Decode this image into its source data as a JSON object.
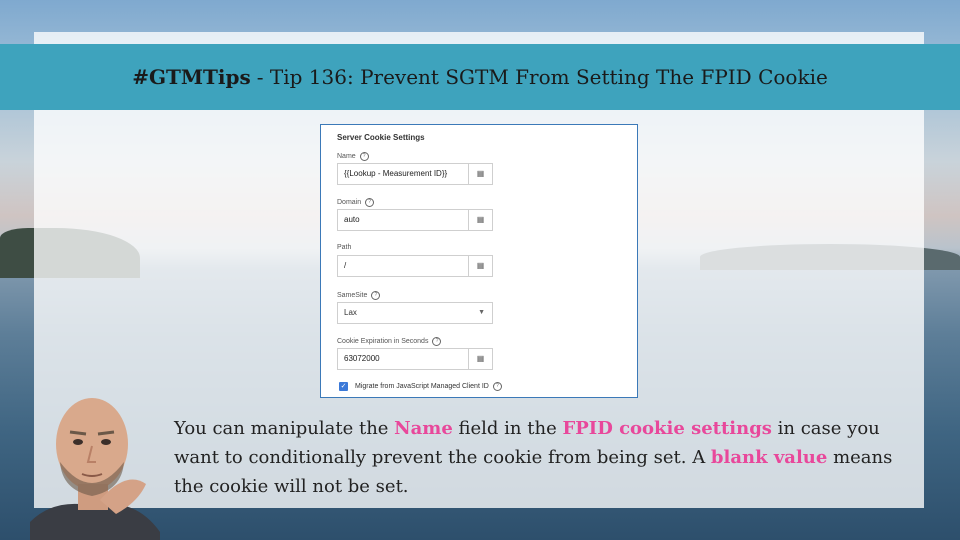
{
  "banner": {
    "hashtag": "#GTMTips",
    "title": "- Tip 136: Prevent SGTM From Setting The FPID Cookie"
  },
  "form": {
    "title": "Server Cookie Settings",
    "name_label": "Name",
    "name_value": "{{Lookup - Measurement ID}}",
    "domain_label": "Domain",
    "domain_value": "auto",
    "path_label": "Path",
    "path_value": "/",
    "samesite_label": "SameSite",
    "samesite_value": "Lax",
    "expiration_label": "Cookie Expiration in Seconds",
    "expiration_value": "63072000",
    "migrate_label": "Migrate from JavaScript Managed Client ID",
    "migrate_checked": true
  },
  "caption": {
    "p1": "You can manipulate the ",
    "h1": "Name",
    "p2": " field in the ",
    "h2": "FPID cookie settings",
    "p3": " in case you want to conditionally prevent the cookie from being set. A ",
    "h3": "blank value",
    "p4": " means the cookie will not be set."
  },
  "icons": {
    "help": "help-circle-icon",
    "variable": "variable-picker-icon",
    "dropdown": "chevron-down-icon",
    "checkbox": "checkmark-icon"
  },
  "colors": {
    "banner": "#3ea3bd",
    "highlight": "#e8489b",
    "checkbox": "#3b79d8"
  }
}
